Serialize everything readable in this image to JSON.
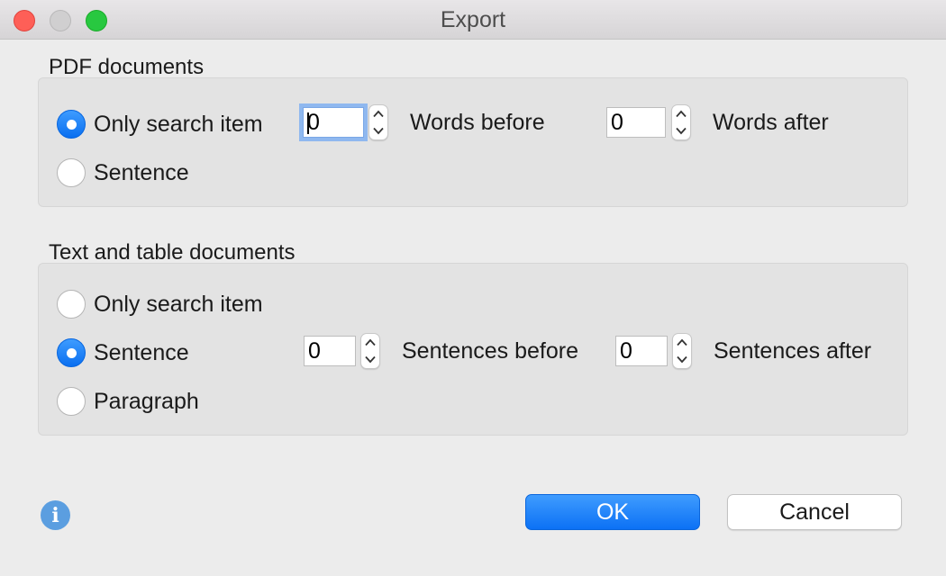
{
  "window": {
    "title": "Export"
  },
  "pdf": {
    "group_label": "PDF documents",
    "options": [
      {
        "label": "Only search item",
        "checked": true
      },
      {
        "label": "Sentence",
        "checked": false
      }
    ],
    "words_before_value": "0",
    "words_before_label": "Words before",
    "words_after_value": "0",
    "words_after_label": "Words after"
  },
  "text": {
    "group_label": "Text and table documents",
    "options": [
      {
        "label": "Only search item",
        "checked": false
      },
      {
        "label": "Sentence",
        "checked": true
      },
      {
        "label": "Paragraph",
        "checked": false
      }
    ],
    "sentences_before_value": "0",
    "sentences_before_label": "Sentences before",
    "sentences_after_value": "0",
    "sentences_after_label": "Sentences after"
  },
  "footer": {
    "info_icon": "info-icon",
    "ok_label": "OK",
    "cancel_label": "Cancel"
  },
  "colors": {
    "accent": "#0a6ff0",
    "close": "#fe5f57",
    "zoom": "#28c840"
  }
}
